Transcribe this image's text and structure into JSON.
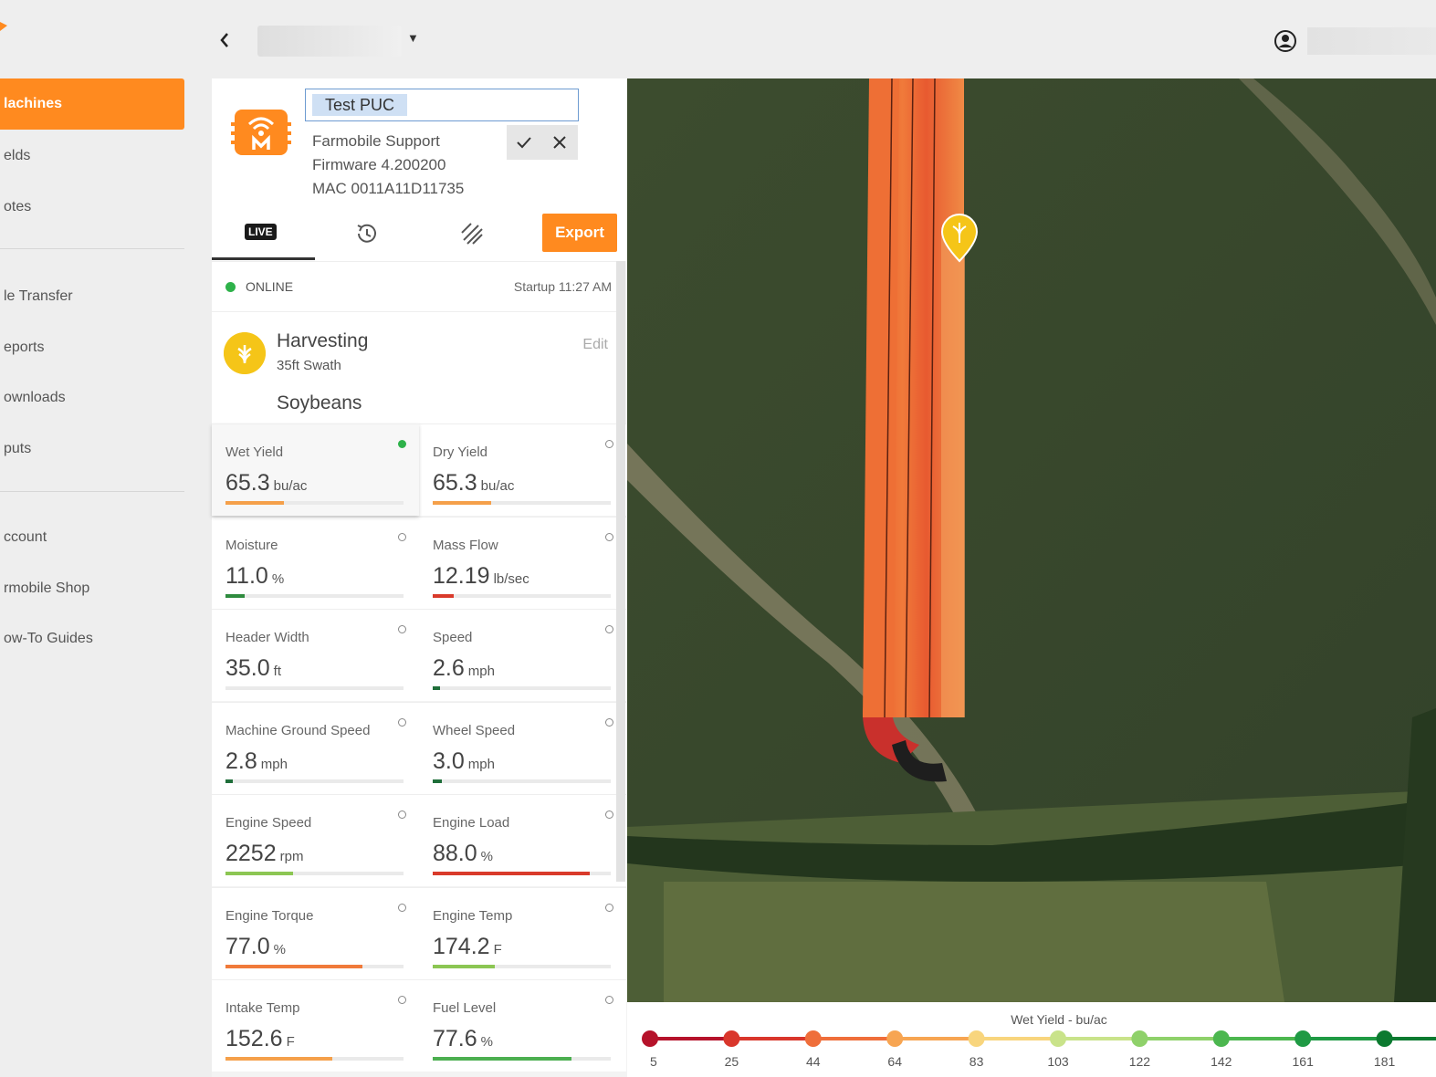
{
  "topbar": {
    "back_icon": "chevron-left-icon",
    "user_icon": "user-circle-icon"
  },
  "sidebar": {
    "items": [
      {
        "label": "lachines"
      },
      {
        "label": "elds"
      },
      {
        "label": "otes"
      },
      {
        "label": "le Transfer"
      },
      {
        "label": "eports"
      },
      {
        "label": "ownloads"
      },
      {
        "label": "puts"
      },
      {
        "label": "ccount"
      },
      {
        "label": "rmobile Shop"
      },
      {
        "label": "ow-To Guides"
      }
    ]
  },
  "device": {
    "name_value": "Test PUC",
    "owner": "Farmobile Support",
    "firmware": "Firmware 4.200200",
    "mac": "MAC 0011A11D11735",
    "confirm_icon": "checkmark-icon",
    "cancel_icon": "close-icon"
  },
  "tabs": {
    "live": "LIVE",
    "history_icon": "history-icon",
    "coverage_icon": "coverage-hatch-icon",
    "export": "Export"
  },
  "status": {
    "online": "ONLINE",
    "startup": "Startup 11:27 AM"
  },
  "operation": {
    "title": "Harvesting",
    "swath": "35ft Swath",
    "crop": "Soybeans",
    "edit": "Edit"
  },
  "metrics": [
    {
      "label": "Wet Yield",
      "value": "65.3",
      "unit": "bu/ac",
      "fill": 0.33,
      "color": "#f5a04a",
      "active": true
    },
    {
      "label": "Dry Yield",
      "value": "65.3",
      "unit": "bu/ac",
      "fill": 0.33,
      "color": "#f5a04a",
      "active": false
    },
    {
      "label": "Moisture",
      "value": "11.0",
      "unit": "%",
      "fill": 0.11,
      "color": "#2e8b3e",
      "active": false
    },
    {
      "label": "Mass Flow",
      "value": "12.19",
      "unit": "lb/sec",
      "fill": 0.12,
      "color": "#d93a2b",
      "active": false
    },
    {
      "label": "Header Width",
      "value": "35.0",
      "unit": "ft",
      "fill": 0,
      "color": "#2e8b3e",
      "active": false
    },
    {
      "label": "Speed",
      "value": "2.6",
      "unit": "mph",
      "fill": 0.04,
      "color": "#1f6e3a",
      "active": false
    },
    {
      "label": "Machine Ground Speed",
      "value": "2.8",
      "unit": "mph",
      "fill": 0.04,
      "color": "#1f6e3a",
      "active": false
    },
    {
      "label": "Wheel Speed",
      "value": "3.0",
      "unit": "mph",
      "fill": 0.05,
      "color": "#1f6e3a",
      "active": false
    },
    {
      "label": "Engine Speed",
      "value": "2252",
      "unit": "rpm",
      "fill": 0.38,
      "color": "#8cc653",
      "active": false
    },
    {
      "label": "Engine Load",
      "value": "88.0",
      "unit": "%",
      "fill": 0.88,
      "color": "#d93a2b",
      "active": false
    },
    {
      "label": "Engine Torque",
      "value": "77.0",
      "unit": "%",
      "fill": 0.77,
      "color": "#f07a3a",
      "active": false
    },
    {
      "label": "Engine Temp",
      "value": "174.2",
      "unit": "F",
      "fill": 0.35,
      "color": "#8cc653",
      "active": false
    },
    {
      "label": "Intake Temp",
      "value": "152.6",
      "unit": "F",
      "fill": 0.6,
      "color": "#f5a04a",
      "active": false
    },
    {
      "label": "Fuel Level",
      "value": "77.6",
      "unit": "%",
      "fill": 0.78,
      "color": "#4caf50",
      "active": false
    }
  ],
  "map": {
    "marker_icon": "wheat-marker-icon"
  },
  "legend": {
    "title": "Wet Yield - bu/ac",
    "ticks": [
      "5",
      "25",
      "44",
      "64",
      "83",
      "103",
      "122",
      "142",
      "161",
      "181"
    ],
    "colors": [
      "#b5122a",
      "#d9362b",
      "#ef6e3a",
      "#f7a552",
      "#f8d57d",
      "#c9e38a",
      "#8fd16a",
      "#4cb74f",
      "#1f9a44",
      "#0c7a30"
    ]
  }
}
